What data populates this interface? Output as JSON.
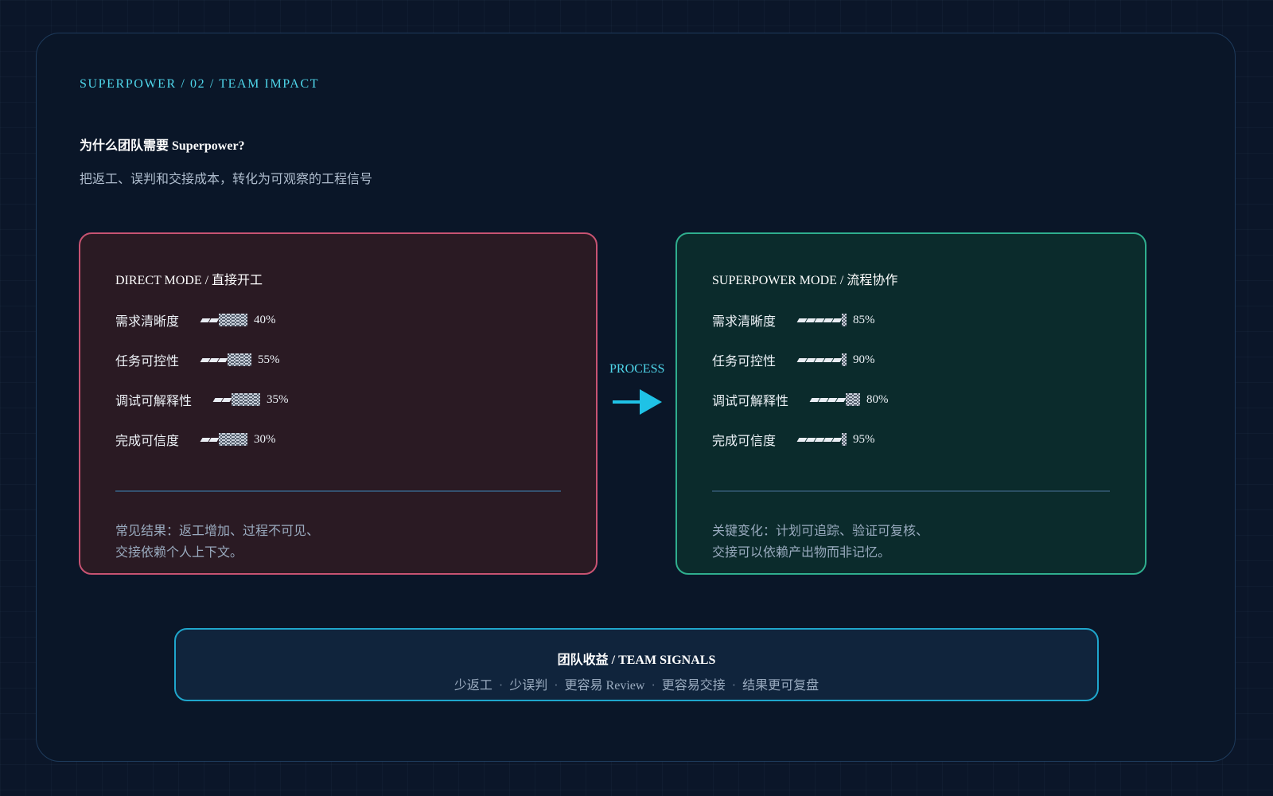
{
  "header": {
    "eyebrow": "SUPERPOWER / 02 / TEAM IMPACT",
    "title": "为什么团队需要 Superpower?",
    "subtitle": "把返工、误判和交接成本，转化为可观察的工程信号"
  },
  "direct_mode": {
    "title": "DIRECT MODE / 直接开工",
    "metrics": [
      {
        "label": "需求清晰度",
        "value": "40%",
        "level": 0.4,
        "bar": {
          "segments": 2,
          "shade_blocks": 6
        }
      },
      {
        "label": "任务可控性",
        "value": "55%",
        "level": 0.55,
        "bar": {
          "segments": 3,
          "shade_blocks": 5
        }
      },
      {
        "label": "调试可解释性",
        "value": "35%",
        "level": 0.35,
        "bar": {
          "segments": 2,
          "shade_blocks": 6
        }
      },
      {
        "label": "完成可信度",
        "value": "30%",
        "level": 0.3,
        "bar": {
          "segments": 2,
          "shade_blocks": 6
        }
      }
    ],
    "footer_lines": [
      "常见结果：返工增加、过程不可见、",
      "交接依赖个人上下文。"
    ],
    "border_color": "#c85372"
  },
  "process": {
    "label": "PROCESS",
    "arrow_color": "#1fc2e6"
  },
  "superpower_mode": {
    "title": "SUPERPOWER MODE / 流程协作",
    "metrics": [
      {
        "label": "需求清晰度",
        "value": "85%",
        "level": 0.85,
        "bar": {
          "segments": 5,
          "shade_blocks": 1
        }
      },
      {
        "label": "任务可控性",
        "value": "90%",
        "level": 0.9,
        "bar": {
          "segments": 5,
          "shade_blocks": 1
        }
      },
      {
        "label": "调试可解释性",
        "value": "80%",
        "level": 0.8,
        "bar": {
          "segments": 4,
          "shade_blocks": 3
        }
      },
      {
        "label": "完成可信度",
        "value": "95%",
        "level": 0.95,
        "bar": {
          "segments": 5,
          "shade_blocks": 1
        }
      }
    ],
    "footer_lines": [
      "关键变化：计划可追踪、验证可复核、",
      "交接可以依赖产出物而非记忆。"
    ],
    "border_color": "#2fae8e"
  },
  "team_signals": {
    "title": "团队收益 / TEAM SIGNALS",
    "items": [
      "少返工",
      "少误判",
      "更容易 Review",
      "更容易交接",
      "结果更可复盘"
    ],
    "separator": "·",
    "border_color": "#1fa6cc"
  },
  "colors": {
    "accent": "#4fd6ea",
    "background": "#0b1629",
    "bar_fill": "#e9edf3"
  }
}
